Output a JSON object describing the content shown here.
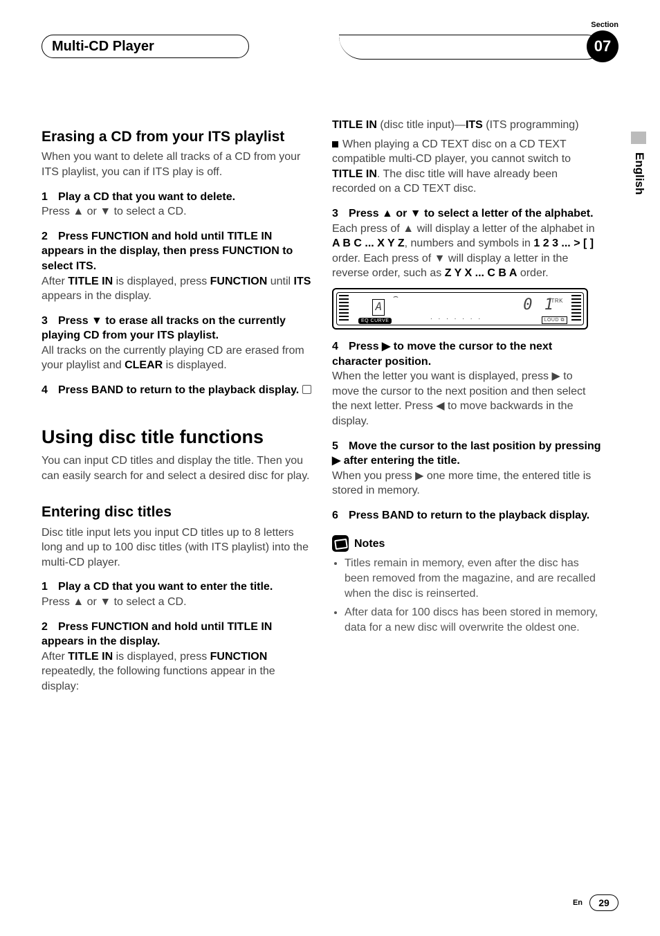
{
  "header": {
    "section_label": "Section",
    "chapter_title": "Multi-CD Player",
    "chapter_number": "07"
  },
  "side": {
    "language": "English"
  },
  "left": {
    "h_erase": "Erasing a CD from your ITS playlist",
    "erase_intro": "When you want to delete all tracks of a CD from your ITS playlist, you can if ITS play is off.",
    "s1_head": "Play a CD that you want to delete.",
    "s1_body_a": "Press ",
    "s1_body_b": " or ",
    "s1_body_c": " to select a CD.",
    "s2_head": "Press FUNCTION and hold until TITLE IN appears in the display, then press FUNCTION to select ITS.",
    "s2_body_a": "After ",
    "s2_body_b": "TITLE IN",
    "s2_body_c": " is displayed, press ",
    "s2_body_d": "FUNCTION",
    "s2_body_e": " until ",
    "s2_body_f": "ITS",
    "s2_body_g": " appears in the display.",
    "s3_head_a": "Press ",
    "s3_head_b": " to erase all tracks on the currently playing CD from your ITS playlist.",
    "s3_body_a": "All tracks on the currently playing CD are erased from your playlist and ",
    "s3_body_b": "CLEAR",
    "s3_body_c": " is displayed.",
    "s4_head": "Press BAND to return to the playback display.",
    "h_using": "Using disc title functions",
    "using_intro": "You can input CD titles and display the title. Then you can easily search for and select a desired disc for play.",
    "h_enter": "Entering disc titles",
    "enter_intro": "Disc title input lets you input CD titles up to 8 letters long and up to 100 disc titles (with ITS playlist) into the multi-CD player.",
    "e1_head": "Play a CD that you want to enter the title.",
    "e1_body_a": "Press ",
    "e1_body_b": " or ",
    "e1_body_c": " to select a CD.",
    "e2_head": "Press FUNCTION and hold until TITLE IN appears in the display.",
    "e2_body_a": "After ",
    "e2_body_b": "TITLE IN",
    "e2_body_c": " is displayed, press ",
    "e2_body_d": "FUNCTION",
    "e2_body_e": " repeatedly, the following functions appear in the display:"
  },
  "right": {
    "line1_a": "TITLE IN",
    "line1_b": " (disc title input)—",
    "line1_c": "ITS",
    "line1_d": " (ITS programming)",
    "note_cd_a": "When playing a CD TEXT disc on a CD TEXT compatible multi-CD player, you cannot switch to ",
    "note_cd_b": "TITLE IN",
    "note_cd_c": ". The disc title will have already been recorded on a CD TEXT disc.",
    "s3_head_a": "Press ",
    "s3_head_b": " or ",
    "s3_head_c": " to select a letter of the alphabet.",
    "s3_body_a": "Each press of ",
    "s3_body_b": " will display a letter of the alphabet in ",
    "s3_body_c": "A B C ... X Y Z",
    "s3_body_d": ", numbers and symbols in ",
    "s3_body_e": "1 2 3 ... > [ ]",
    "s3_body_f": " order. Each press of ",
    "s3_body_g": " will display a letter in the reverse order, such as ",
    "s3_body_h": "Z Y X ... C B A",
    "s3_body_i": " order.",
    "display": {
      "eq": "EQ CURVE",
      "loud": "LOUD",
      "trk": "TRK",
      "seg": "0 1",
      "title_char": "A",
      "dots": ". . . . . . ."
    },
    "s4_head_a": "Press ",
    "s4_head_b": " to move the cursor to the next character position.",
    "s4_body_a": "When the letter you want is displayed, press ",
    "s4_body_b": " to move the cursor to the next position and then select the next letter. Press ",
    "s4_body_c": " to move backwards in the display.",
    "s5_head_a": "Move the cursor to the last position by pressing ",
    "s5_head_b": " after entering the title.",
    "s5_body_a": "When you press ",
    "s5_body_b": " one more time, the entered title is stored in memory.",
    "s6_head": "Press BAND to return to the playback display.",
    "notes_title": "Notes",
    "note1": "Titles remain in memory, even after the disc has been removed from the magazine, and are recalled when the disc is reinserted.",
    "note2": "After data for 100 discs has been stored in memory, data for a new disc will overwrite the oldest one."
  },
  "footer": {
    "lang": "En",
    "page": "29"
  },
  "glyph": {
    "up": "▲",
    "down": "▼",
    "right": "▶",
    "left": "◀"
  }
}
